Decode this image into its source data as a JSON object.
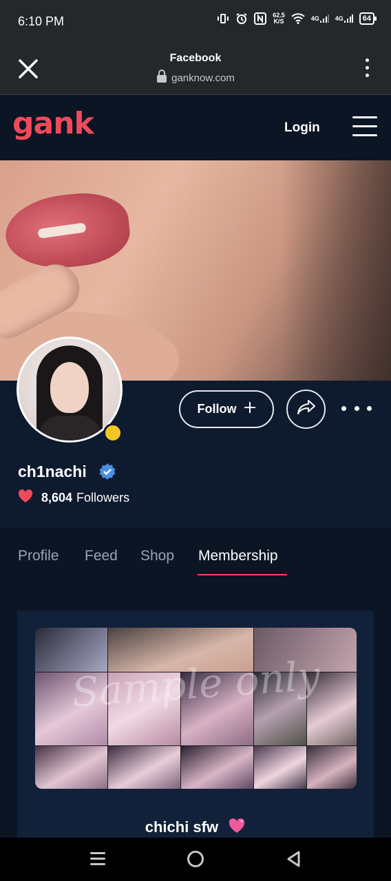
{
  "status_bar": {
    "time": "6:10 PM",
    "net_speed_value": "62.5",
    "net_speed_unit": "K/S",
    "signal1": "4G",
    "signal2": "4G",
    "battery": "64",
    "icons": [
      "vibrate-icon",
      "alarm-icon",
      "nfc-icon",
      "wifi-icon",
      "signal-icon",
      "battery-icon"
    ]
  },
  "browser": {
    "title": "Facebook",
    "url": "ganknow.com"
  },
  "site_header": {
    "logo": "gank",
    "login_label": "Login",
    "brand_color": "#ef4a5a"
  },
  "profile": {
    "username": "ch1nachi",
    "followers_count": "8,604",
    "followers_label": "Followers",
    "follow_label": "Follow",
    "online_status_color": "#f3c623",
    "verified_color": "#4a90e2"
  },
  "tabs": [
    {
      "label": "Profile",
      "active": false
    },
    {
      "label": "Feed",
      "active": false
    },
    {
      "label": "Shop",
      "active": false
    },
    {
      "label": "Membership",
      "active": true
    }
  ],
  "membership": {
    "watermark": "Sample only",
    "tier_name": "chichi sfw"
  }
}
